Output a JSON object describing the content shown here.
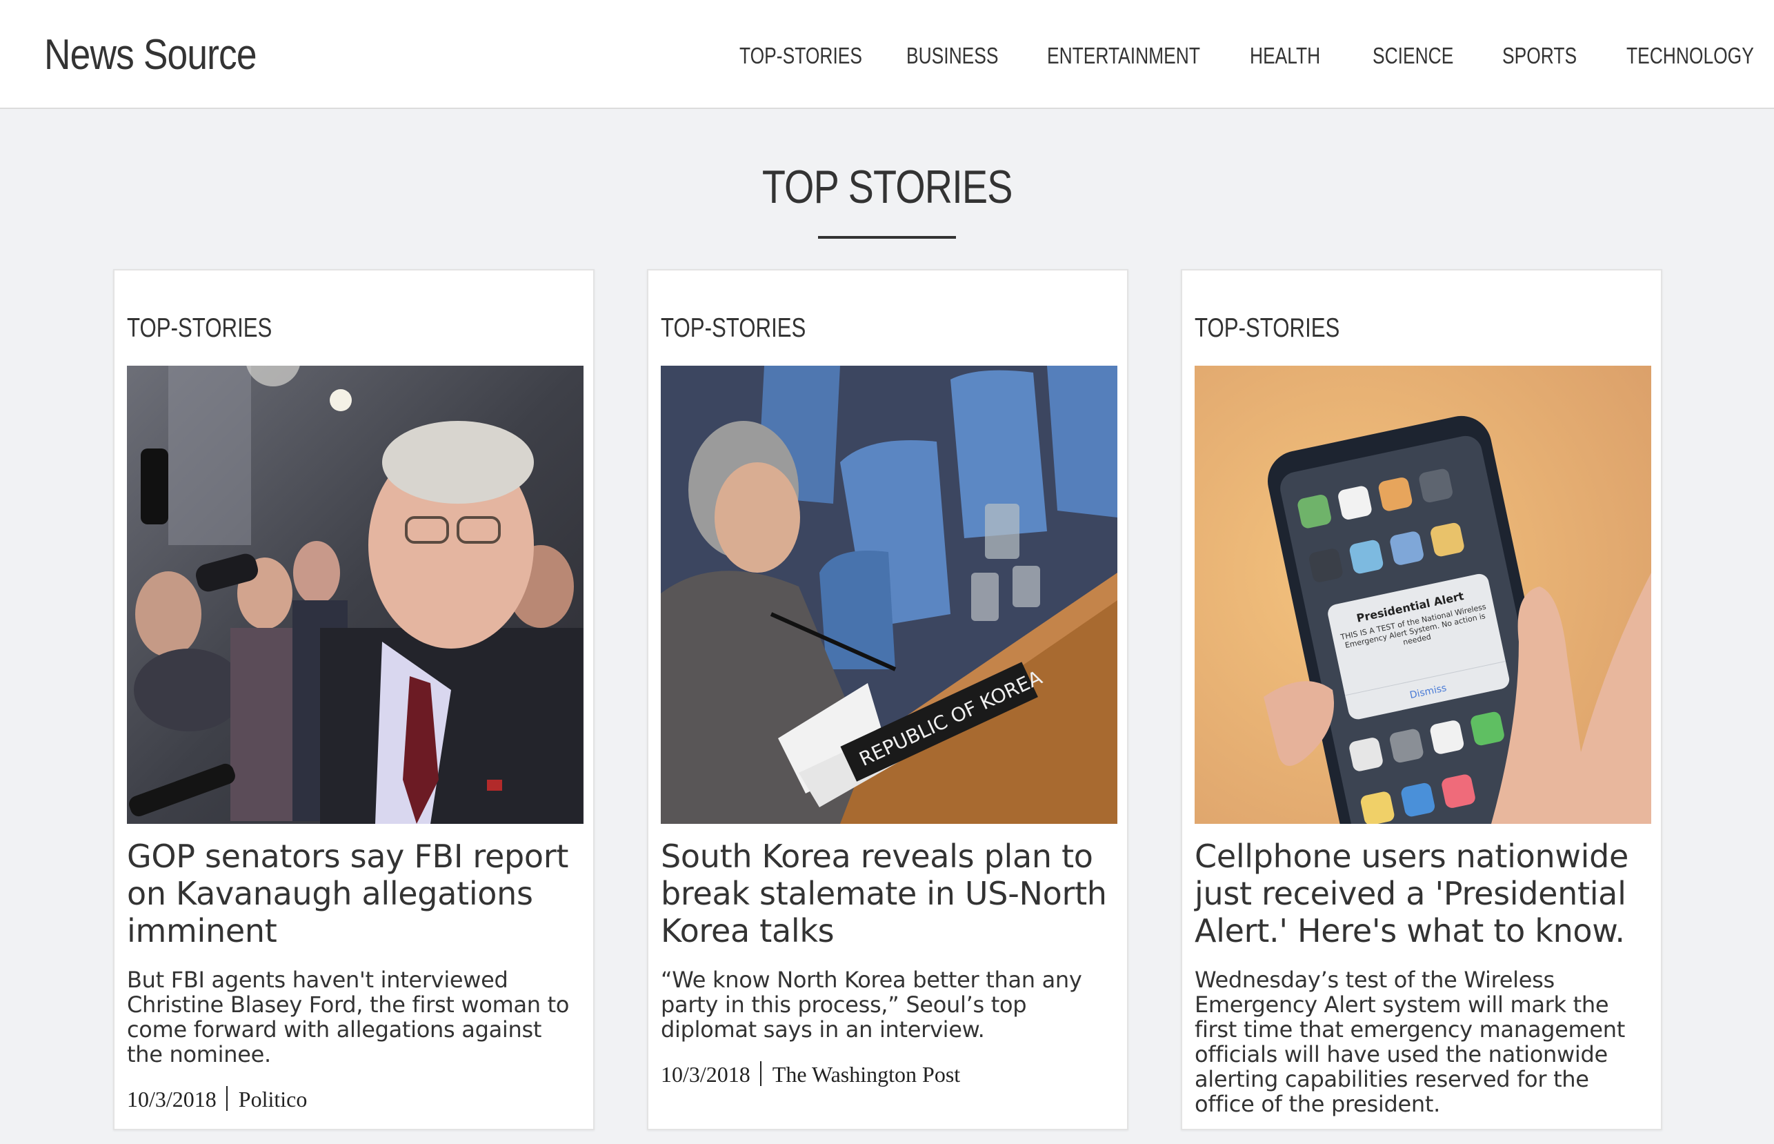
{
  "header": {
    "brand": "News Source",
    "nav": [
      {
        "label": "TOP-STORIES"
      },
      {
        "label": "BUSINESS"
      },
      {
        "label": "ENTERTAINMENT"
      },
      {
        "label": "HEALTH"
      },
      {
        "label": "SCIENCE"
      },
      {
        "label": "SPORTS"
      },
      {
        "label": "TECHNOLOGY"
      }
    ]
  },
  "main": {
    "section_title": "TOP STORIES",
    "cards": [
      {
        "category": "TOP-STORIES",
        "title": "GOP senators say FBI report on Kavanaugh allegations imminent",
        "description": "But FBI agents haven't interviewed Christine Blasey Ford, the first woman to come forward with allegations against the nominee.",
        "date": "10/3/2018",
        "source": "Politico",
        "image": "senator-with-reporters-photo"
      },
      {
        "category": "TOP-STORIES",
        "title": "South Korea reveals plan to break stalemate in US-North Korea talks",
        "description": "“We know North Korea better than any party in this process,” Seoul’s top diplomat says in an interview.",
        "date": "10/3/2018",
        "source": "The Washington Post",
        "image": "diplomat-at-un-council-photo",
        "placard": "REPUBLIC OF KOREA"
      },
      {
        "category": "TOP-STORIES",
        "title": "Cellphone users nationwide just received a 'Presidential Alert.' Here's what to know.",
        "description": "Wednesday’s test of the Wireless Emergency Alert system will mark the first time that emergency management officials will have used the nationwide alerting capabilities reserved for the office of the president.",
        "image": "phone-presidential-alert-photo",
        "alert": {
          "heading": "Presidential Alert",
          "body": "THIS IS A TEST of the National Wireless Emergency Alert System. No action is needed",
          "dismiss": "Dismiss"
        }
      }
    ]
  },
  "colors": {
    "page_background": "#f1f2f4",
    "card_background": "#ffffff",
    "text": "#333333"
  }
}
